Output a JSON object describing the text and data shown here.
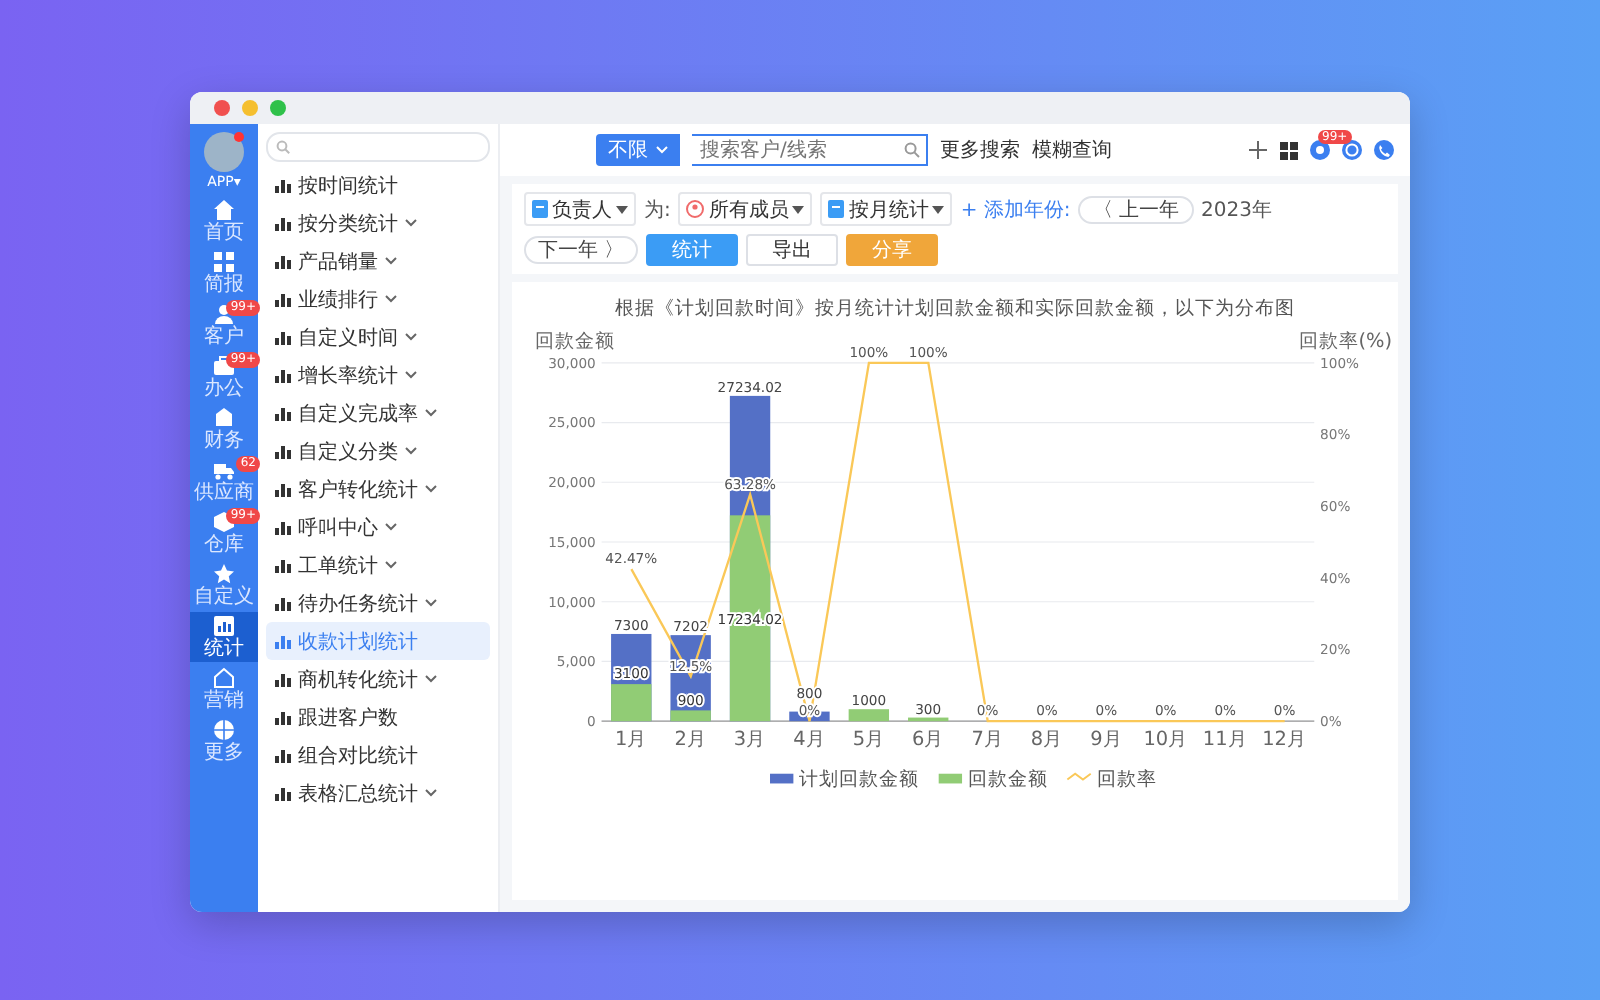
{
  "window": {
    "controls": [
      {
        "color": "#f0504f"
      },
      {
        "color": "#f5bf2f"
      },
      {
        "color": "#2fc14a"
      }
    ]
  },
  "rail": {
    "account": {
      "label": "APP▾",
      "unread": true
    },
    "items": [
      {
        "label": "首页",
        "selected": false
      },
      {
        "label": "简报",
        "selected": false
      },
      {
        "label": "客户",
        "badge": "99+",
        "selected": false
      },
      {
        "label": "办公",
        "badge": "99+",
        "selected": false
      },
      {
        "label": "财务",
        "selected": false
      },
      {
        "label": "供应商",
        "badge": "62",
        "selected": false
      },
      {
        "label": "仓库",
        "badge": "99+",
        "selected": false
      },
      {
        "label": "自定义",
        "selected": false
      },
      {
        "label": "统计",
        "selected": true
      },
      {
        "label": "营销",
        "selected": false
      },
      {
        "label": "更多",
        "selected": false
      }
    ]
  },
  "menu": {
    "items": [
      {
        "label": "按时间统计",
        "submenu": false,
        "selected": false
      },
      {
        "label": "按分类统计",
        "submenu": true,
        "selected": false
      },
      {
        "label": "产品销量",
        "submenu": true,
        "selected": false
      },
      {
        "label": "业绩排行",
        "submenu": true,
        "selected": false
      },
      {
        "label": "自定义时间",
        "submenu": true,
        "selected": false
      },
      {
        "label": "增长率统计",
        "submenu": true,
        "selected": false
      },
      {
        "label": "自定义完成率",
        "submenu": true,
        "selected": false
      },
      {
        "label": "自定义分类",
        "submenu": true,
        "selected": false
      },
      {
        "label": "客户转化统计",
        "submenu": true,
        "selected": false
      },
      {
        "label": "呼叫中心",
        "submenu": true,
        "selected": false
      },
      {
        "label": "工单统计",
        "submenu": true,
        "selected": false
      },
      {
        "label": "待办任务统计",
        "submenu": true,
        "selected": false
      },
      {
        "label": "收款计划统计",
        "submenu": false,
        "selected": true
      },
      {
        "label": "商机转化统计",
        "submenu": true,
        "selected": false
      },
      {
        "label": "跟进客户数",
        "submenu": false,
        "selected": false
      },
      {
        "label": "组合对比统计",
        "submenu": false,
        "selected": false
      },
      {
        "label": "表格汇总统计",
        "submenu": true,
        "selected": false
      }
    ]
  },
  "header": {
    "search_scope": "不限",
    "search": {
      "placeholder": "搜索客户/线索"
    },
    "links": [
      "更多搜索",
      "模糊查询"
    ],
    "notification_badge": "99+"
  },
  "toolbar": {
    "owner": "负责人",
    "for_label": "为:",
    "members": "所有成员",
    "period": "按月统计",
    "add_year": "+ 添加年份:",
    "prev": "〈 上一年",
    "year": "2023年",
    "next": "下一年 〉",
    "buttons": [
      {
        "label": "统计",
        "kind": "primary"
      },
      {
        "label": "导出",
        "kind": "plain"
      },
      {
        "label": "分享",
        "kind": "warning"
      }
    ]
  },
  "chart_data": {
    "type": "bar",
    "title": "根据《计划回款时间》按月统计计划回款金额和实际回款金额，以下为分布图",
    "ylabel": "回款金额",
    "y2label": "回款率(%)",
    "categories": [
      "1月",
      "2月",
      "3月",
      "4月",
      "5月",
      "6月",
      "7月",
      "8月",
      "9月",
      "10月",
      "11月",
      "12月"
    ],
    "series": [
      {
        "name": "计划回款金额",
        "color": "#5470c6",
        "values": [
          7300,
          7202,
          27234.02,
          800,
          0,
          0,
          0,
          0,
          0,
          0,
          0,
          0
        ],
        "value_labels": [
          "7300",
          "7202",
          "27234.02",
          "800",
          null,
          null,
          null,
          null,
          null,
          null,
          null,
          null
        ]
      },
      {
        "name": "回款金额",
        "color": "#91cc75",
        "values": [
          3100,
          900,
          17234.02,
          0,
          1000,
          300,
          0,
          0,
          0,
          0,
          0,
          0
        ],
        "value_labels": [
          "3100",
          "900",
          "17234.02",
          null,
          "1000",
          "300",
          null,
          null,
          null,
          null,
          null,
          null
        ]
      },
      {
        "name": "回款率",
        "color": "#fac858",
        "type": "line",
        "axis": "y2",
        "values": [
          42.47,
          12.5,
          63.28,
          0,
          100,
          100,
          0,
          0,
          0,
          0,
          0,
          0
        ],
        "value_labels": [
          "42.47%",
          "12.5%",
          "63.28%",
          "0%",
          "100%",
          "100%",
          "0%",
          "0%",
          "0%",
          "0%",
          "0%",
          "0%"
        ]
      }
    ],
    "grid": true,
    "legend": true,
    "y2lim": [
      0,
      100
    ],
    "ylim": [
      0,
      30000
    ],
    "yticks": [
      {
        "value": 0,
        "label": "0"
      },
      {
        "value": 5000,
        "label": "5,000"
      },
      {
        "value": 10000,
        "label": "10,000"
      },
      {
        "value": 15000,
        "label": "15,000"
      },
      {
        "value": 20000,
        "label": "20,000"
      },
      {
        "value": 25000,
        "label": "25,000"
      },
      {
        "value": 30000,
        "label": "30,000"
      }
    ],
    "y2ticks": [
      {
        "value": 0,
        "label": "0%"
      },
      {
        "value": 20,
        "label": "20%"
      },
      {
        "value": 40,
        "label": "40%"
      },
      {
        "value": 60,
        "label": "60%"
      },
      {
        "value": 80,
        "label": "80%"
      },
      {
        "value": 100,
        "label": "100%"
      }
    ]
  }
}
